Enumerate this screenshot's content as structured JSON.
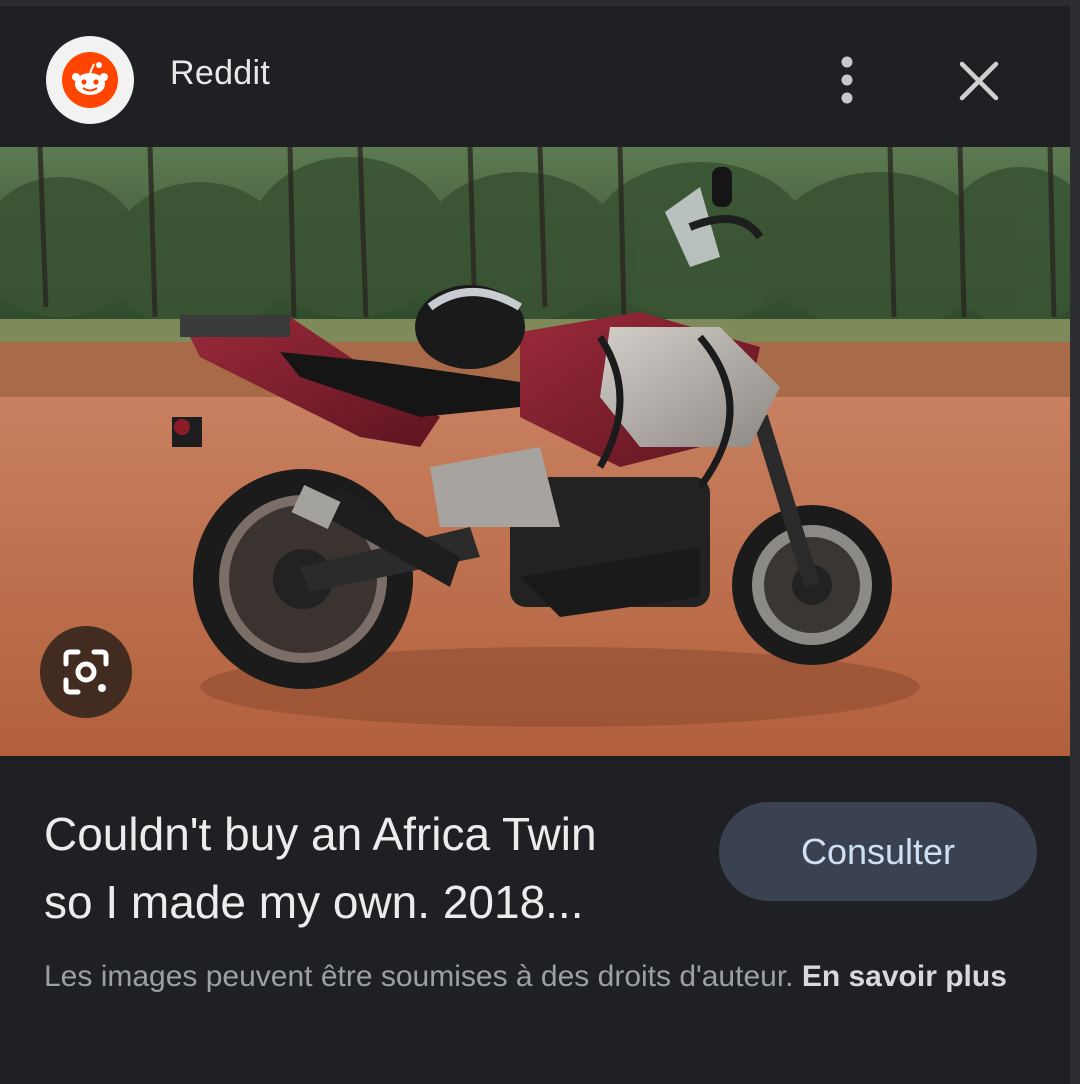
{
  "header": {
    "source": "Reddit",
    "logo_icon": "reddit-alien-icon",
    "more_icon": "more-vert-icon",
    "close_icon": "close-icon"
  },
  "image": {
    "description_icon": "lens-search-icon",
    "colors": {
      "sky": "#e7ece6",
      "forest": "#3c5a35",
      "dirt": "#c07550",
      "bike_red": "#7a1d2a",
      "bike_silver": "#b9b6b2"
    }
  },
  "caption": {
    "title_line1": "Couldn't buy an Africa Twin",
    "title_line2": "so I made my own. 2018...",
    "visit_label": "Consulter",
    "copyright_text": "Les images peuvent être soumises à des droits d'auteur. ",
    "learn_more": "En savoir plus"
  },
  "colors": {
    "background": "#1f2024",
    "button_bg": "#3a4150",
    "button_text": "#cfe0f6",
    "muted_text": "#9aa0a6",
    "reddit_orange": "#ff4500"
  }
}
